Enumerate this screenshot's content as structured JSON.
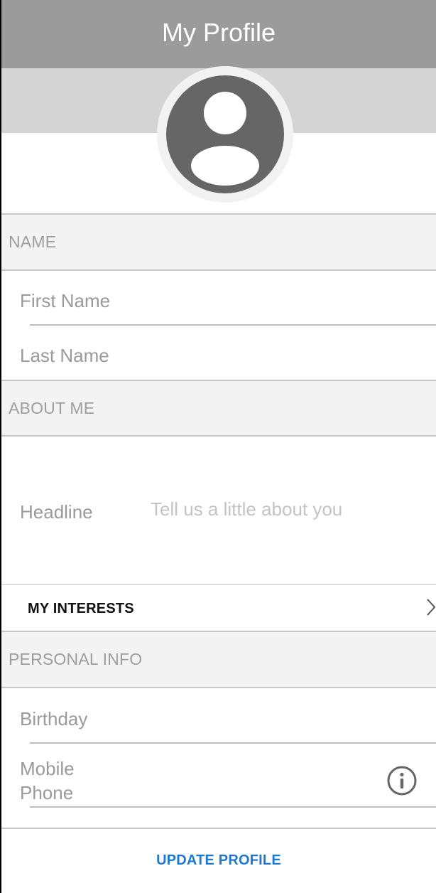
{
  "header": {
    "title": "My Profile"
  },
  "avatar": {
    "icon": "user-avatar-icon",
    "color": "#666666"
  },
  "sections": {
    "name": "NAME",
    "about": "ABOUT ME",
    "personal": "PERSONAL INFO"
  },
  "name_fields": {
    "first_name_placeholder": "First Name",
    "last_name_placeholder": "Last Name"
  },
  "about": {
    "headline_label": "Headline",
    "headline_placeholder": "Tell us a little about you"
  },
  "interests": {
    "label": "MY INTERESTS",
    "icon": "chevron-right-icon"
  },
  "personal": {
    "birthday_placeholder": "Birthday",
    "mobile_line1": "Mobile",
    "mobile_line2": "Phone",
    "info_icon": "info-icon"
  },
  "actions": {
    "update_label": "UPDATE PROFILE",
    "accent": "#1e7ad0"
  }
}
